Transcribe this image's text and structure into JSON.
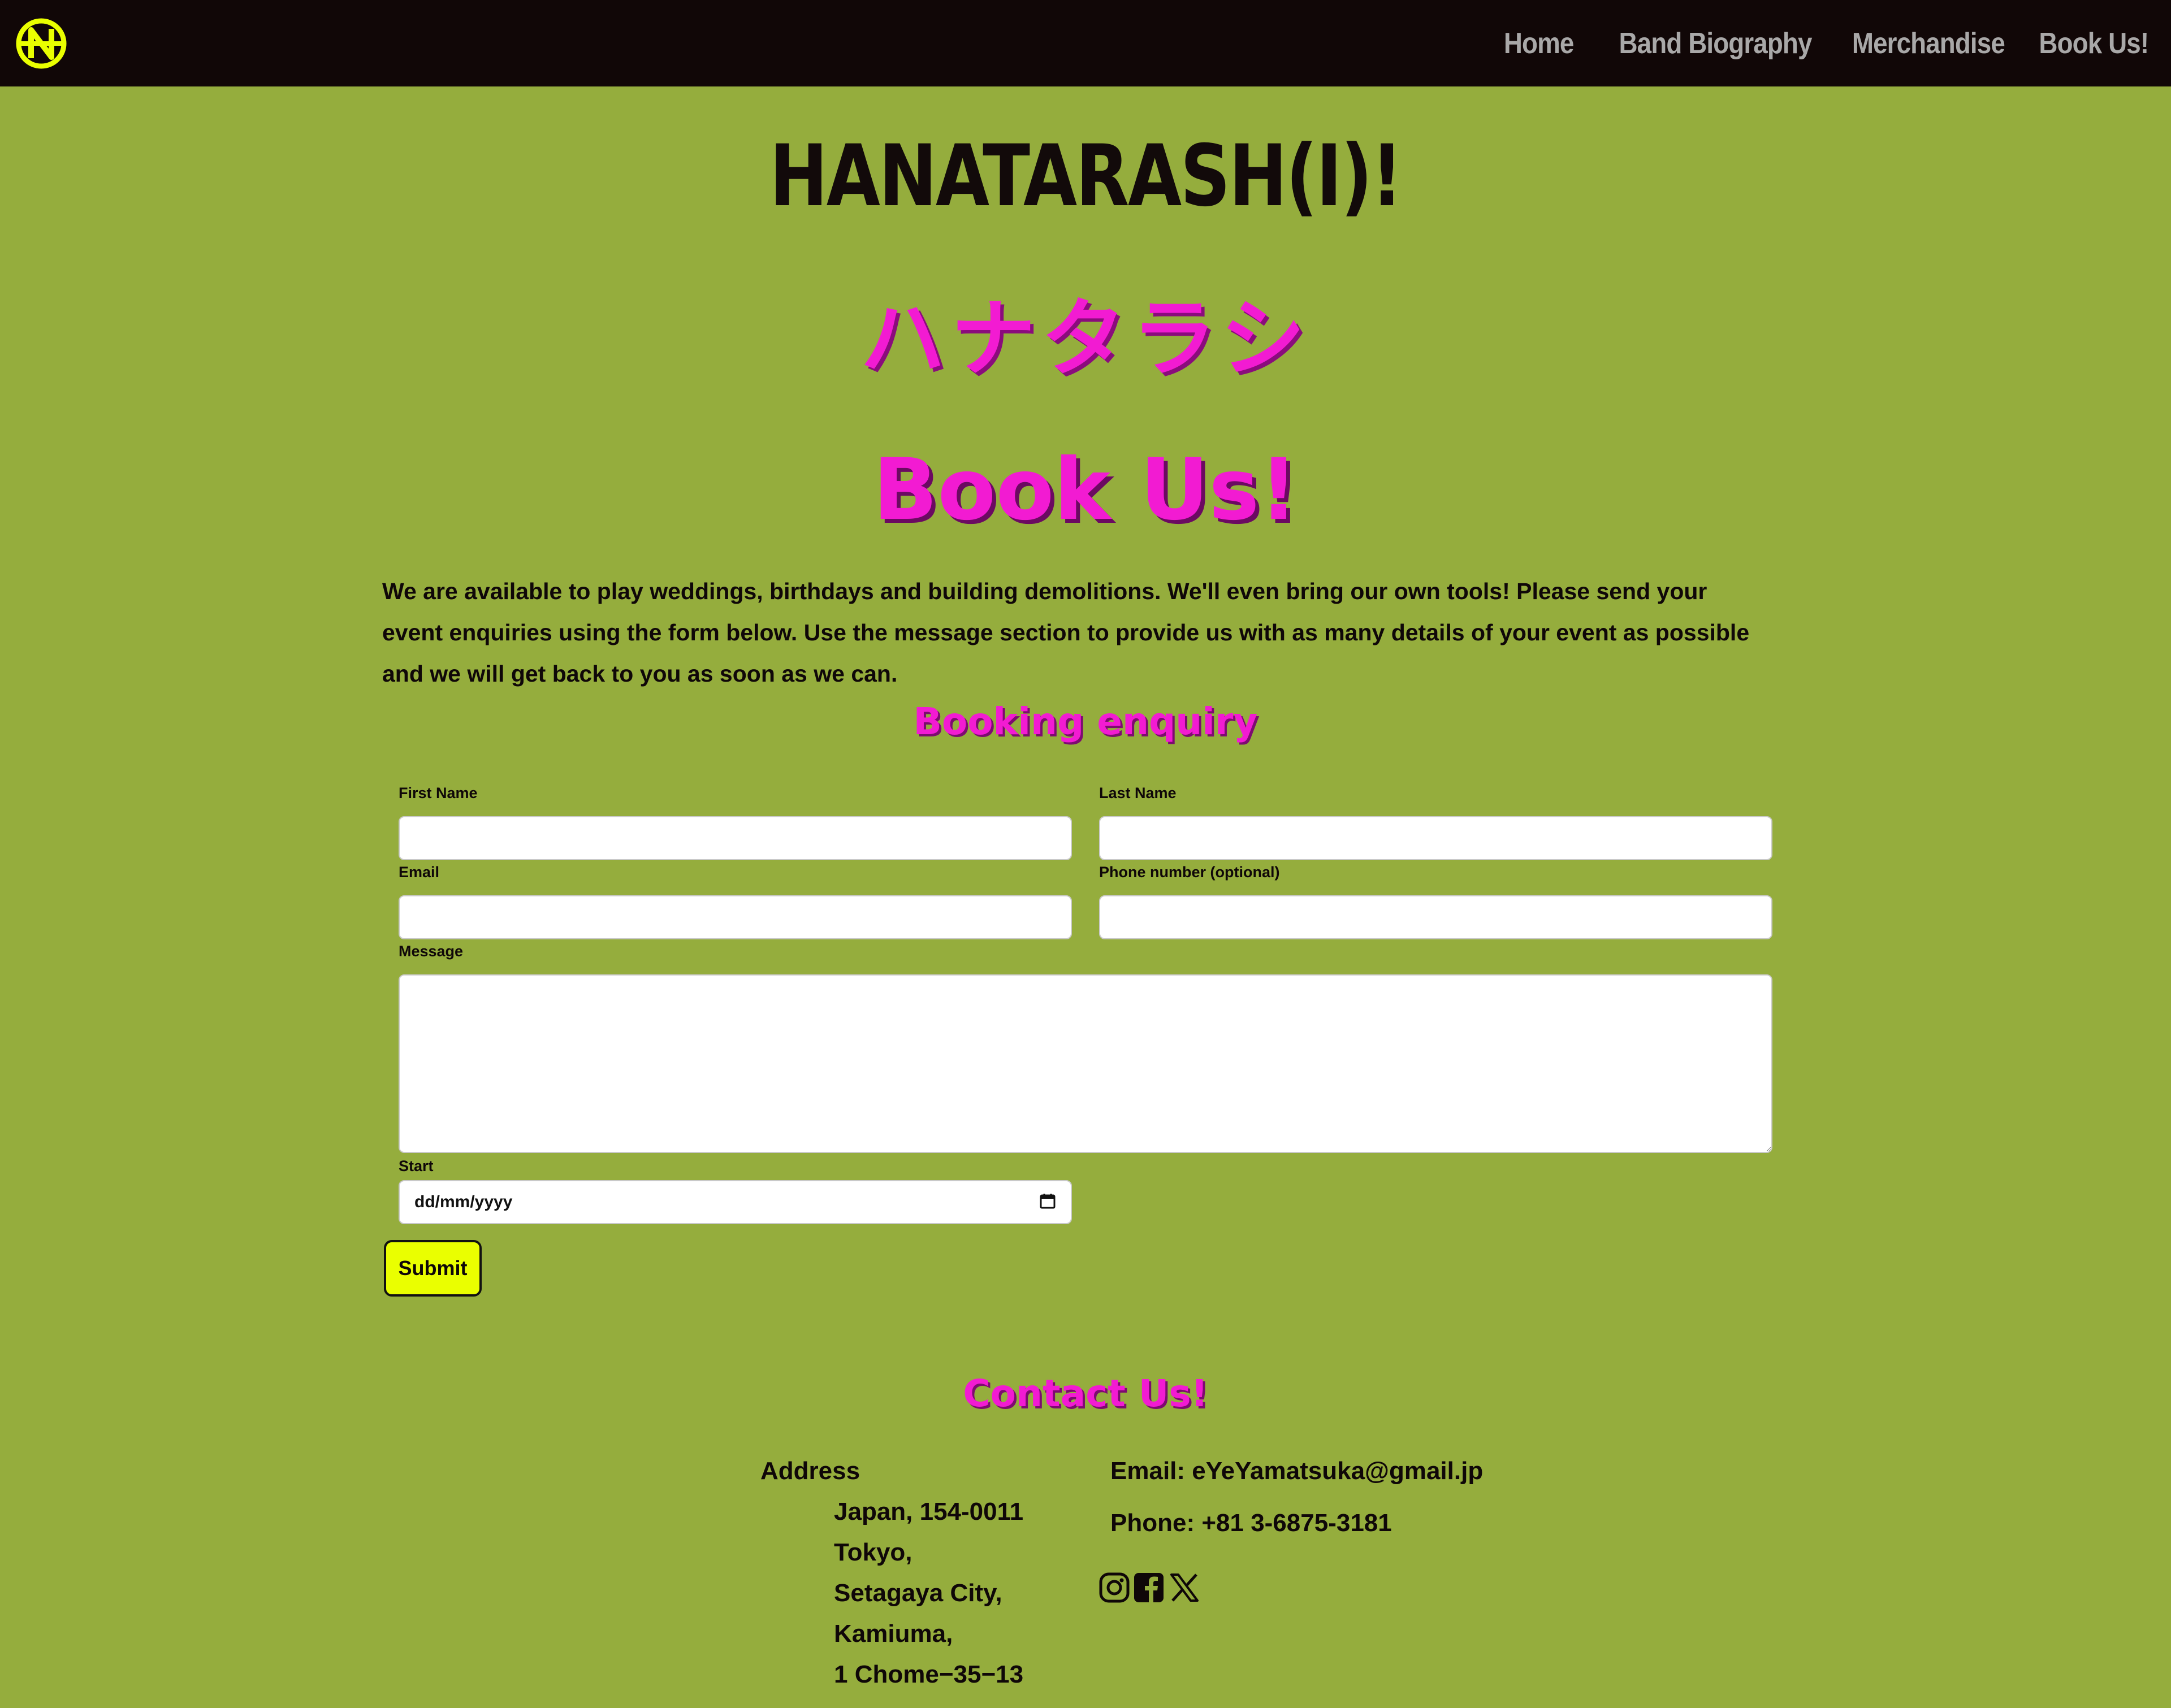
{
  "nav": {
    "logo_icon": "band-logo-icon",
    "links": [
      "Home",
      "Band Biography",
      "Merchandise",
      "Book Us!"
    ]
  },
  "header": {
    "title": "HANATARASH(I)!",
    "title_jp": "ハナタラシ"
  },
  "page": {
    "heading": "Book Us!",
    "intro": "We are available to play weddings, birthdays and building demolitions. We'll even bring our own tools! Please send your event enquiries using the form below. Use the message section to provide us with as many details of your event as possible and we will get back to you as soon as we can."
  },
  "form": {
    "heading": "Booking enquiry",
    "first_name_label": "First Name",
    "first_name_value": "",
    "last_name_label": "Last Name",
    "last_name_value": "",
    "email_label": "Email",
    "email_value": "",
    "phone_label": "Phone number (optional)",
    "phone_value": "",
    "message_label": "Message",
    "message_value": "",
    "start_label": "Start",
    "start_placeholder": "dd/mm/yyyy",
    "submit_label": "Submit"
  },
  "contact": {
    "heading": "Contact Us!",
    "address_label": "Address",
    "address_lines": [
      "Japan, 154-0011",
      "Tokyo,",
      "Setagaya City,",
      "Kamiuma,",
      "1 Chome−35−13"
    ],
    "email": "Email: eYeYamatsuka@gmail.jp",
    "phone": "Phone: +81 3-6875-3181",
    "social_icons": [
      "instagram-icon",
      "facebook-icon",
      "x-icon"
    ]
  },
  "colors": {
    "background": "#95ad3d",
    "navbar": "#110707",
    "nav_link": "#a9a8a8",
    "accent_pink": "#f21bd2",
    "logo_yellow": "#eaff00",
    "submit_button": "#eaff00"
  }
}
